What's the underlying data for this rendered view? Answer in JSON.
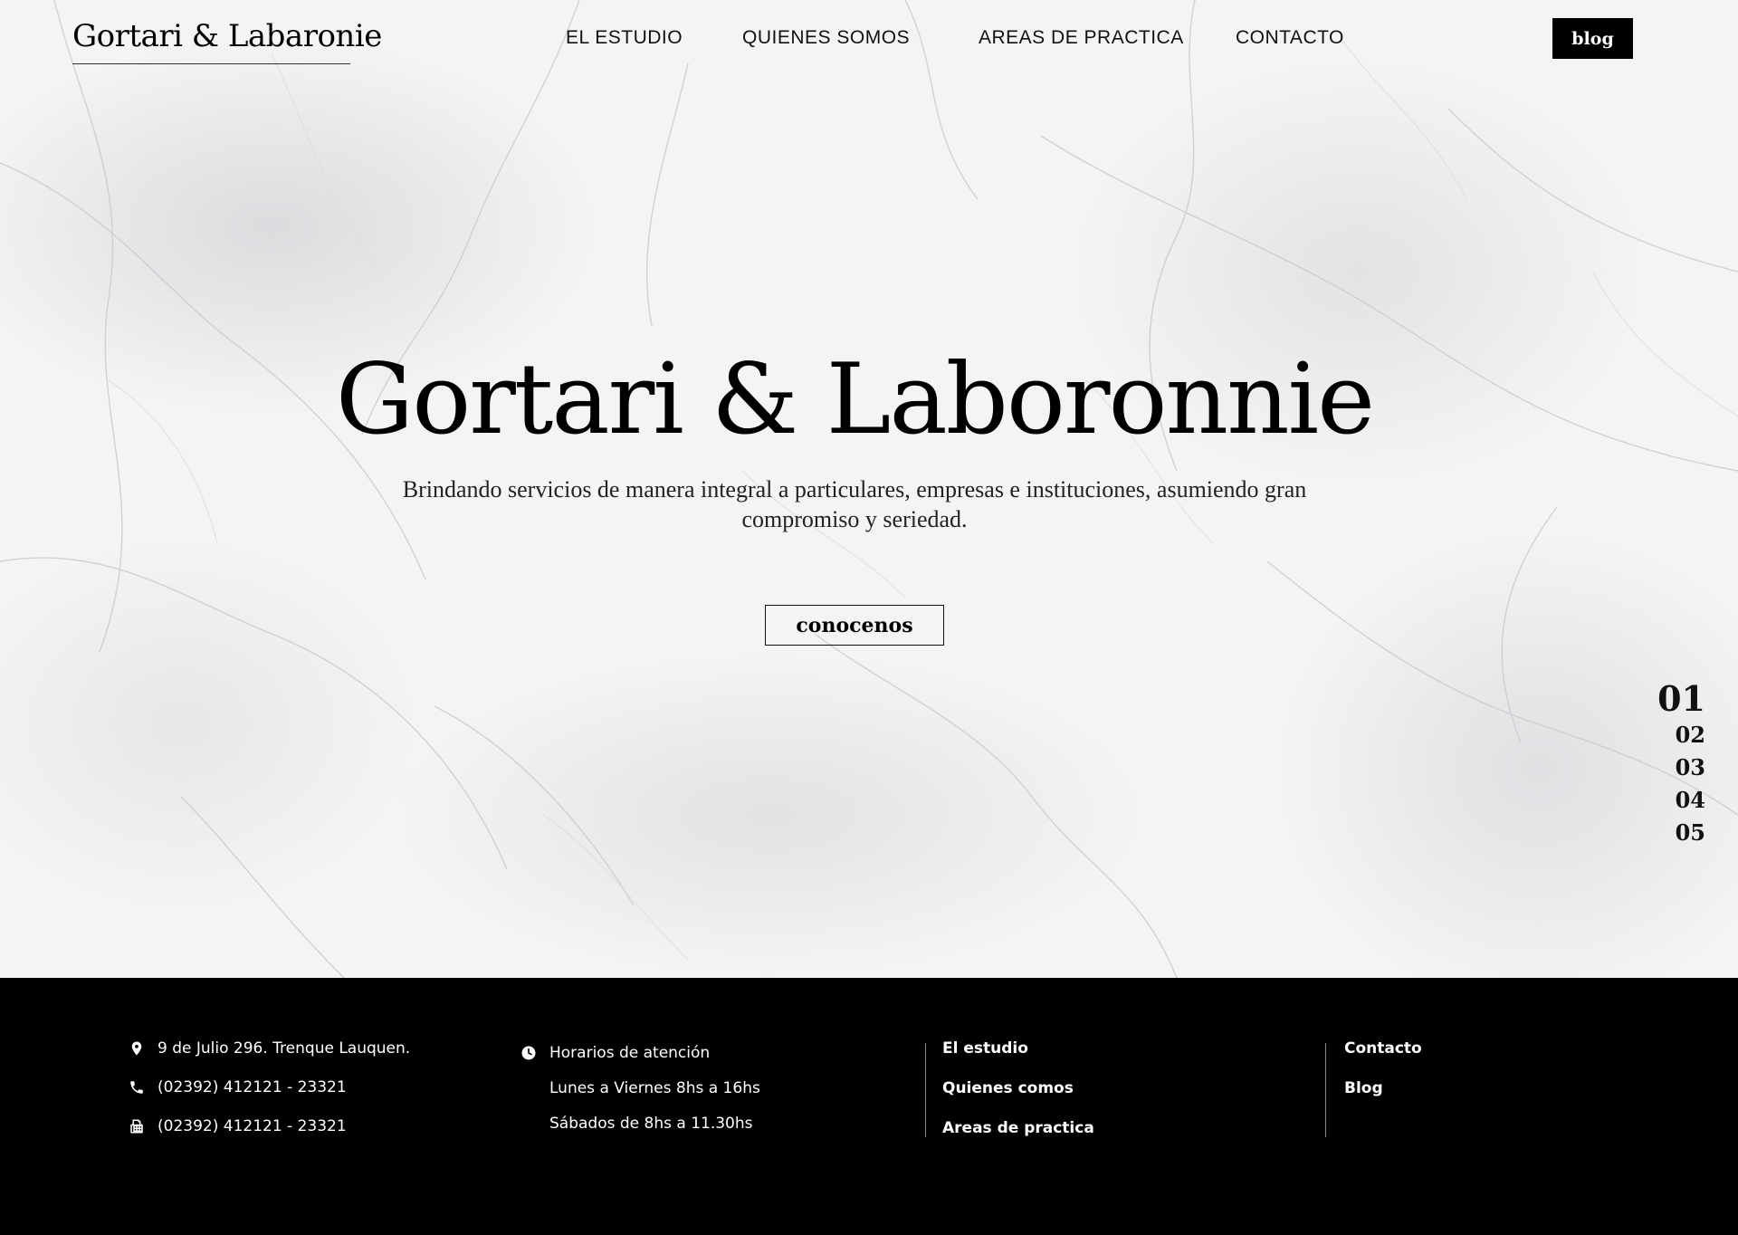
{
  "header": {
    "logo": "Gortari & Labaronie",
    "nav": [
      "EL ESTUDIO",
      "QUIENES SOMOS",
      "AREAS DE PRACTICA",
      "CONTACTO"
    ],
    "blog_label": "blog"
  },
  "hero": {
    "title": "Gortari & Laboronnie",
    "subtitle": "Brindando servicios de manera integral a particulares, empresas e instituciones, asumiendo gran compromiso y seriedad.",
    "cta_label": "conocenos"
  },
  "slides": {
    "items": [
      "01",
      "02",
      "03",
      "04",
      "05"
    ],
    "active_index": 0
  },
  "footer": {
    "contact": {
      "address": "9 de Julio 296. Trenque Lauquen.",
      "phone": "(02392) 412121 - 23321",
      "fax": "(02392) 412121 - 23321"
    },
    "hours": {
      "title": "Horarios de atención",
      "weekdays": "Lunes a Viernes 8hs a 16hs",
      "saturday": "Sábados de 8hs a 11.30hs"
    },
    "links_col1": [
      "El estudio",
      "Quienes comos",
      "Areas de practica"
    ],
    "links_col2": [
      "Contacto",
      "Blog"
    ]
  },
  "colors": {
    "footer_bg": "#000000",
    "accent": "#000000",
    "hero_bg": "#f4f4f5"
  },
  "icons": [
    "map-pin-icon",
    "phone-icon",
    "fax-icon",
    "clock-icon"
  ]
}
